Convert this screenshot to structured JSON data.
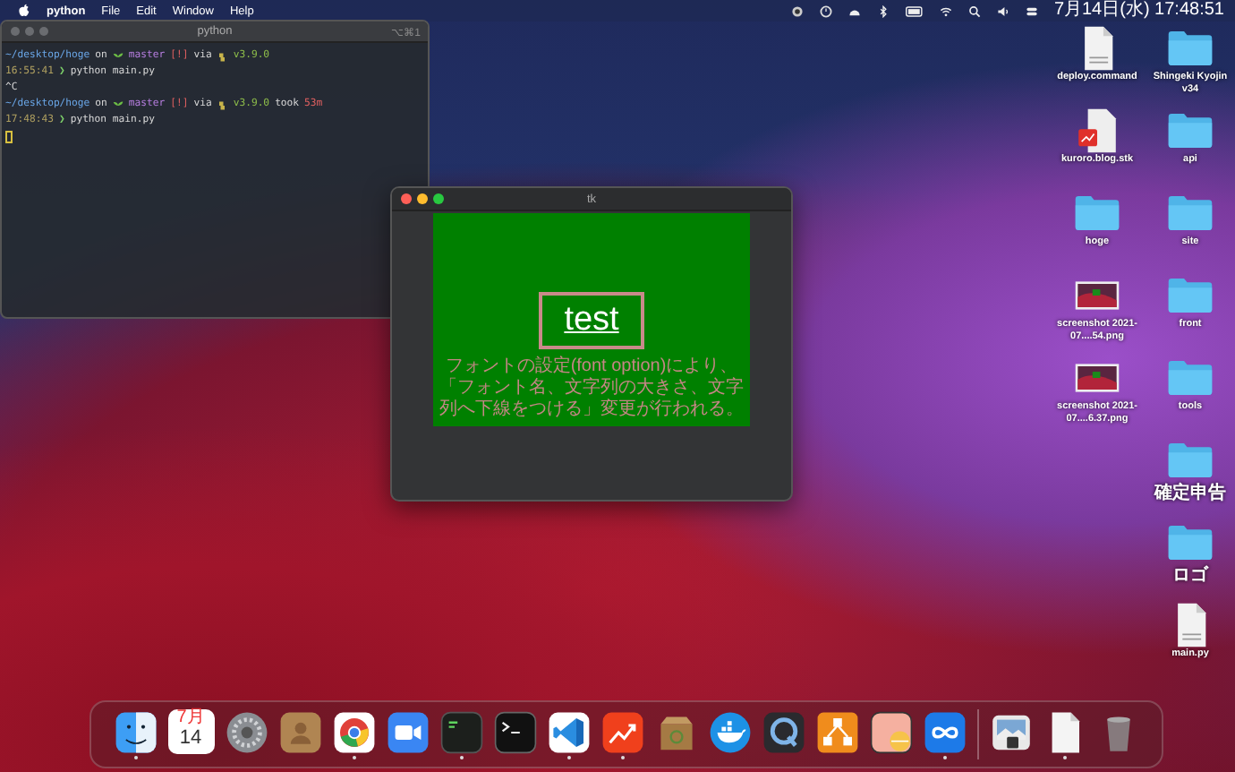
{
  "menubar": {
    "app_name": "python",
    "menus": [
      "File",
      "Edit",
      "Window",
      "Help"
    ],
    "clock": "7月14日(水) 17:48:51"
  },
  "terminal": {
    "title": "python",
    "shortcut": "⌥⌘1",
    "lines": [
      {
        "segments": [
          {
            "kind": "path",
            "text": "~/desktop/hoge"
          },
          {
            "kind": "plain",
            "text": "on"
          },
          {
            "kind": "branch",
            "text": "master"
          },
          {
            "kind": "status",
            "text": "[!]"
          },
          {
            "kind": "plain",
            "text": "via"
          },
          {
            "kind": "version",
            "text": "v3.9.0"
          }
        ]
      },
      {
        "segments": [
          {
            "kind": "time",
            "text": "16:55:41"
          },
          {
            "kind": "arrow",
            "text": "❯"
          },
          {
            "kind": "plain",
            "text": "python main.py"
          }
        ]
      },
      {
        "segments": [
          {
            "kind": "plain",
            "text": "^C"
          }
        ]
      },
      {
        "segments": [
          {
            "kind": "path",
            "text": "~/desktop/hoge"
          },
          {
            "kind": "plain",
            "text": "on"
          },
          {
            "kind": "branch",
            "text": "master"
          },
          {
            "kind": "status",
            "text": "[!]"
          },
          {
            "kind": "plain",
            "text": "via"
          },
          {
            "kind": "version",
            "text": "v3.9.0"
          },
          {
            "kind": "plain",
            "text": "took"
          },
          {
            "kind": "status",
            "text": "53m"
          }
        ]
      },
      {
        "segments": [
          {
            "kind": "time",
            "text": "17:48:43"
          },
          {
            "kind": "arrow",
            "text": "❯"
          },
          {
            "kind": "plain",
            "text": "python main.py"
          }
        ]
      }
    ],
    "cursor": true
  },
  "tk_window": {
    "title": "tk",
    "label": "test",
    "message": "フォントの設定(font option)により、「フォント名、文字列の大きさ、文字列へ下線をつける」変更が行われる。"
  },
  "desktop_columns": [
    [
      {
        "kind": "shell",
        "label": "deploy.command"
      },
      {
        "kind": "stk",
        "label": "kuroro.blog.stk"
      },
      {
        "kind": "folder",
        "label": "hoge"
      },
      {
        "kind": "image",
        "label": "screenshot 2021-07....54.png"
      },
      {
        "kind": "image",
        "label": "screenshot 2021-07....6.37.png"
      }
    ],
    [
      {
        "kind": "folder",
        "label": "Shingeki Kyojin v34"
      },
      {
        "kind": "folder",
        "label": "api"
      },
      {
        "kind": "folder",
        "label": "site"
      },
      {
        "kind": "folder",
        "label": "front"
      },
      {
        "kind": "folder",
        "label": "tools"
      },
      {
        "kind": "folder",
        "label": "確定申告"
      },
      {
        "kind": "folder",
        "label": "ロゴ"
      },
      {
        "kind": "python",
        "label": "main.py"
      }
    ]
  ],
  "dock": {
    "apps": [
      {
        "kind": "face",
        "running": true
      },
      {
        "kind": "calendar",
        "month": "7月",
        "day": "14",
        "running": false
      },
      {
        "kind": "gear",
        "running": false
      },
      {
        "kind": "contacts",
        "running": false
      },
      {
        "kind": "browser",
        "running": true
      },
      {
        "kind": "camera",
        "running": false
      },
      {
        "kind": "console",
        "running": true
      },
      {
        "kind": "terminal",
        "running": false
      },
      {
        "kind": "code",
        "running": true
      },
      {
        "kind": "chart",
        "running": true
      },
      {
        "kind": "box",
        "running": false
      },
      {
        "kind": "whale",
        "running": false
      },
      {
        "kind": "player",
        "running": false
      },
      {
        "kind": "diagram",
        "running": false
      },
      {
        "kind": "pill",
        "running": false
      },
      {
        "kind": "infinity",
        "running": true
      }
    ],
    "others": [
      {
        "kind": "photo",
        "running": false
      },
      {
        "kind": "document",
        "running": true
      },
      {
        "kind": "trash",
        "running": false
      }
    ]
  }
}
